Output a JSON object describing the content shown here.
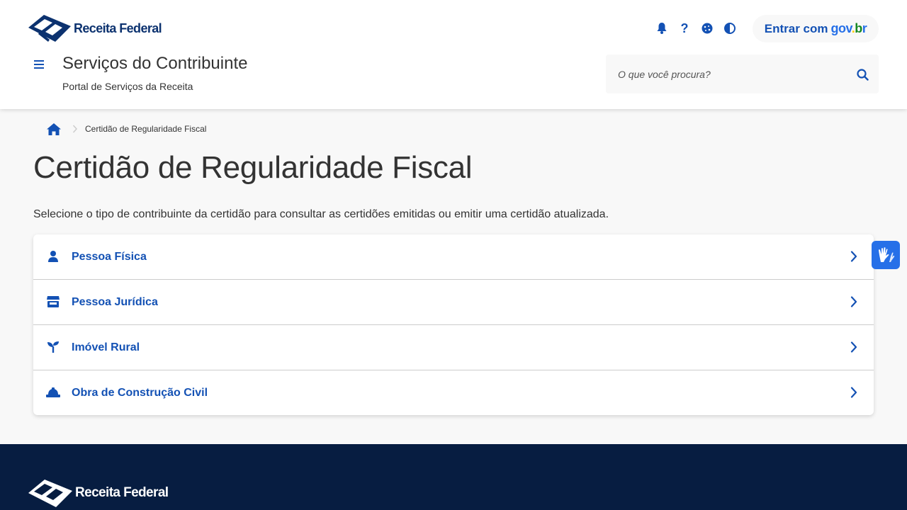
{
  "header": {
    "logo_text": "Receita Federal",
    "icons": [
      "bell-icon",
      "help-icon",
      "cookie-icon",
      "contrast-icon"
    ],
    "help_glyph": "?",
    "login": {
      "label": "Entrar com",
      "brand": [
        "gov",
        ".",
        "b",
        "r"
      ]
    },
    "site_title": "Serviços do Contribuinte",
    "site_subtitle": "Portal de Serviços da Receita",
    "search_placeholder": "O que você procura?"
  },
  "breadcrumb": {
    "home_icon": "home-icon",
    "current": "Certidão de Regularidade Fiscal"
  },
  "main": {
    "title": "Certidão de Regularidade Fiscal",
    "description": "Selecione o tipo de contribuinte da certidão para consultar as certidões emitidas ou emitir uma certidão atualizada.",
    "options": [
      {
        "label": "Pessoa Física",
        "icon": "person-icon"
      },
      {
        "label": "Pessoa Jurídica",
        "icon": "store-icon"
      },
      {
        "label": "Imóvel Rural",
        "icon": "seedling-icon"
      },
      {
        "label": "Obra de Construção Civil",
        "icon": "hard-hat-icon"
      }
    ]
  },
  "footer": {
    "logo_text": "Receita Federal"
  },
  "colors": {
    "primary": "#1351b4",
    "logo_navy": "#0c326f",
    "footer_bg": "#071d41",
    "page_bg": "#f8f8f8",
    "vlibras_bg": "#2670e8"
  }
}
